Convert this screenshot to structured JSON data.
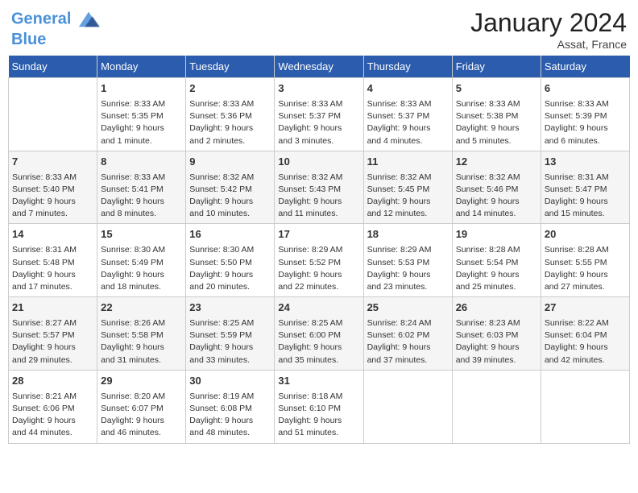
{
  "header": {
    "logo_line1": "General",
    "logo_line2": "Blue",
    "month": "January 2024",
    "location": "Assat, France"
  },
  "days_of_week": [
    "Sunday",
    "Monday",
    "Tuesday",
    "Wednesday",
    "Thursday",
    "Friday",
    "Saturday"
  ],
  "weeks": [
    [
      {
        "day": "",
        "info": ""
      },
      {
        "day": "1",
        "info": "Sunrise: 8:33 AM\nSunset: 5:35 PM\nDaylight: 9 hours\nand 1 minute."
      },
      {
        "day": "2",
        "info": "Sunrise: 8:33 AM\nSunset: 5:36 PM\nDaylight: 9 hours\nand 2 minutes."
      },
      {
        "day": "3",
        "info": "Sunrise: 8:33 AM\nSunset: 5:37 PM\nDaylight: 9 hours\nand 3 minutes."
      },
      {
        "day": "4",
        "info": "Sunrise: 8:33 AM\nSunset: 5:37 PM\nDaylight: 9 hours\nand 4 minutes."
      },
      {
        "day": "5",
        "info": "Sunrise: 8:33 AM\nSunset: 5:38 PM\nDaylight: 9 hours\nand 5 minutes."
      },
      {
        "day": "6",
        "info": "Sunrise: 8:33 AM\nSunset: 5:39 PM\nDaylight: 9 hours\nand 6 minutes."
      }
    ],
    [
      {
        "day": "7",
        "info": "Sunrise: 8:33 AM\nSunset: 5:40 PM\nDaylight: 9 hours\nand 7 minutes."
      },
      {
        "day": "8",
        "info": "Sunrise: 8:33 AM\nSunset: 5:41 PM\nDaylight: 9 hours\nand 8 minutes."
      },
      {
        "day": "9",
        "info": "Sunrise: 8:32 AM\nSunset: 5:42 PM\nDaylight: 9 hours\nand 10 minutes."
      },
      {
        "day": "10",
        "info": "Sunrise: 8:32 AM\nSunset: 5:43 PM\nDaylight: 9 hours\nand 11 minutes."
      },
      {
        "day": "11",
        "info": "Sunrise: 8:32 AM\nSunset: 5:45 PM\nDaylight: 9 hours\nand 12 minutes."
      },
      {
        "day": "12",
        "info": "Sunrise: 8:32 AM\nSunset: 5:46 PM\nDaylight: 9 hours\nand 14 minutes."
      },
      {
        "day": "13",
        "info": "Sunrise: 8:31 AM\nSunset: 5:47 PM\nDaylight: 9 hours\nand 15 minutes."
      }
    ],
    [
      {
        "day": "14",
        "info": "Sunrise: 8:31 AM\nSunset: 5:48 PM\nDaylight: 9 hours\nand 17 minutes."
      },
      {
        "day": "15",
        "info": "Sunrise: 8:30 AM\nSunset: 5:49 PM\nDaylight: 9 hours\nand 18 minutes."
      },
      {
        "day": "16",
        "info": "Sunrise: 8:30 AM\nSunset: 5:50 PM\nDaylight: 9 hours\nand 20 minutes."
      },
      {
        "day": "17",
        "info": "Sunrise: 8:29 AM\nSunset: 5:52 PM\nDaylight: 9 hours\nand 22 minutes."
      },
      {
        "day": "18",
        "info": "Sunrise: 8:29 AM\nSunset: 5:53 PM\nDaylight: 9 hours\nand 23 minutes."
      },
      {
        "day": "19",
        "info": "Sunrise: 8:28 AM\nSunset: 5:54 PM\nDaylight: 9 hours\nand 25 minutes."
      },
      {
        "day": "20",
        "info": "Sunrise: 8:28 AM\nSunset: 5:55 PM\nDaylight: 9 hours\nand 27 minutes."
      }
    ],
    [
      {
        "day": "21",
        "info": "Sunrise: 8:27 AM\nSunset: 5:57 PM\nDaylight: 9 hours\nand 29 minutes."
      },
      {
        "day": "22",
        "info": "Sunrise: 8:26 AM\nSunset: 5:58 PM\nDaylight: 9 hours\nand 31 minutes."
      },
      {
        "day": "23",
        "info": "Sunrise: 8:25 AM\nSunset: 5:59 PM\nDaylight: 9 hours\nand 33 minutes."
      },
      {
        "day": "24",
        "info": "Sunrise: 8:25 AM\nSunset: 6:00 PM\nDaylight: 9 hours\nand 35 minutes."
      },
      {
        "day": "25",
        "info": "Sunrise: 8:24 AM\nSunset: 6:02 PM\nDaylight: 9 hours\nand 37 minutes."
      },
      {
        "day": "26",
        "info": "Sunrise: 8:23 AM\nSunset: 6:03 PM\nDaylight: 9 hours\nand 39 minutes."
      },
      {
        "day": "27",
        "info": "Sunrise: 8:22 AM\nSunset: 6:04 PM\nDaylight: 9 hours\nand 42 minutes."
      }
    ],
    [
      {
        "day": "28",
        "info": "Sunrise: 8:21 AM\nSunset: 6:06 PM\nDaylight: 9 hours\nand 44 minutes."
      },
      {
        "day": "29",
        "info": "Sunrise: 8:20 AM\nSunset: 6:07 PM\nDaylight: 9 hours\nand 46 minutes."
      },
      {
        "day": "30",
        "info": "Sunrise: 8:19 AM\nSunset: 6:08 PM\nDaylight: 9 hours\nand 48 minutes."
      },
      {
        "day": "31",
        "info": "Sunrise: 8:18 AM\nSunset: 6:10 PM\nDaylight: 9 hours\nand 51 minutes."
      },
      {
        "day": "",
        "info": ""
      },
      {
        "day": "",
        "info": ""
      },
      {
        "day": "",
        "info": ""
      }
    ]
  ]
}
